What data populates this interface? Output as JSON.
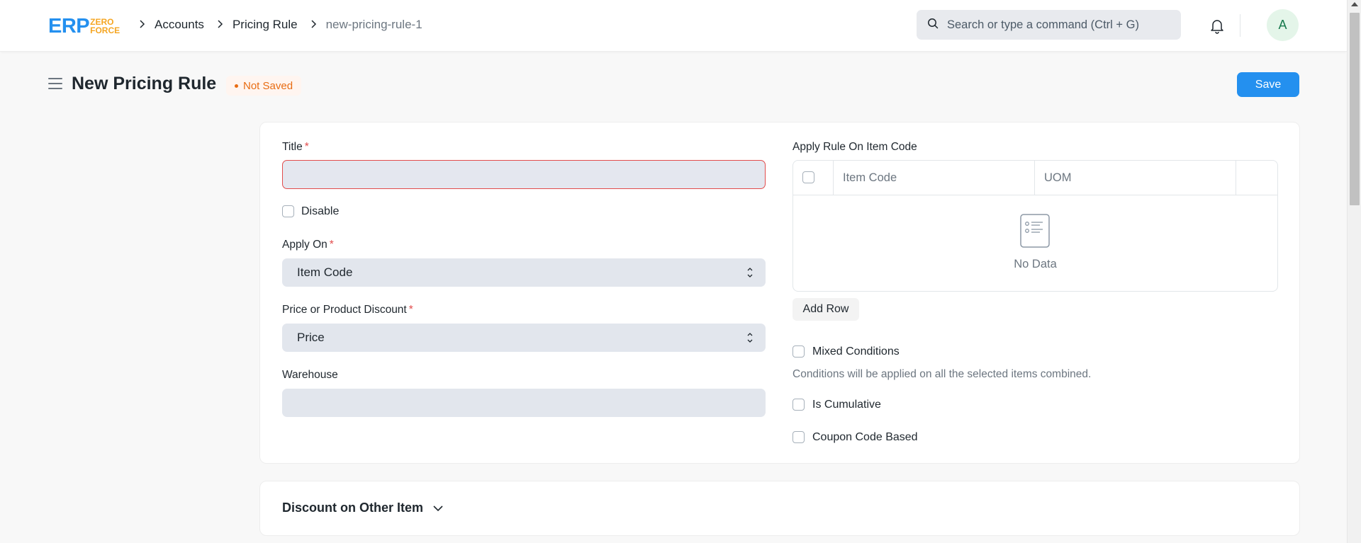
{
  "navbar": {
    "logo_main": "ERP",
    "logo_sub_top": "ZERO",
    "logo_sub_bottom": "FORCE",
    "breadcrumbs": [
      "Accounts",
      "Pricing Rule",
      "new-pricing-rule-1"
    ],
    "search_placeholder": "Search or type a command (Ctrl + G)",
    "avatar_initial": "A"
  },
  "page": {
    "title": "New Pricing Rule",
    "status": "Not Saved",
    "save_label": "Save"
  },
  "form": {
    "title_label": "Title",
    "title_value": "",
    "disable_label": "Disable",
    "apply_on_label": "Apply On",
    "apply_on_value": "Item Code",
    "price_discount_label": "Price or Product Discount",
    "price_discount_value": "Price",
    "warehouse_label": "Warehouse",
    "warehouse_value": "",
    "apply_rule_label": "Apply Rule On Item Code",
    "grid_columns": [
      "Item Code",
      "UOM"
    ],
    "grid_empty": "No Data",
    "add_row_label": "Add Row",
    "mixed_conditions_label": "Mixed Conditions",
    "mixed_conditions_help": "Conditions will be applied on all the selected items combined.",
    "is_cumulative_label": "Is Cumulative",
    "coupon_code_label": "Coupon Code Based"
  },
  "sections": {
    "discount_other_item": "Discount on Other Item"
  },
  "colors": {
    "primary": "#2490ef",
    "status_warning": "#e86c13",
    "required": "#e24c4c"
  }
}
